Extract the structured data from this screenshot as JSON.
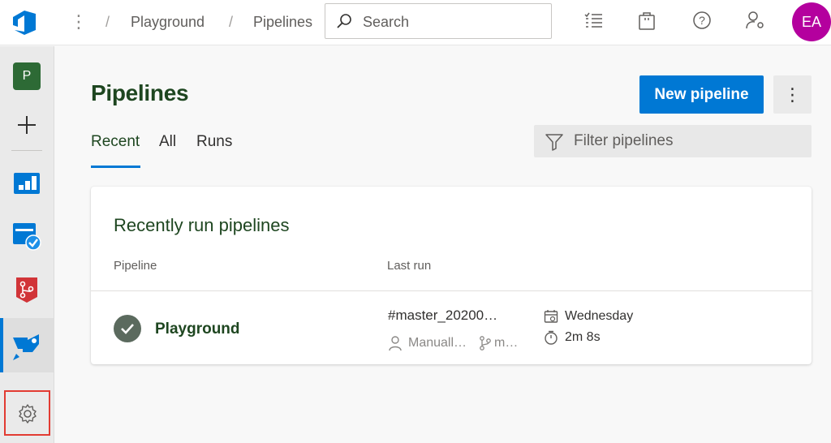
{
  "topbar": {
    "breadcrumb": [
      "Playground",
      "Pipelines"
    ],
    "search_placeholder": "Search",
    "avatar_initials": "EA"
  },
  "sidebar": {
    "project_initial": "P",
    "items": [
      "project",
      "add",
      "boards",
      "test-plans",
      "repos",
      "pipelines",
      "project-settings"
    ]
  },
  "main": {
    "title": "Pipelines",
    "new_pipeline_label": "New pipeline",
    "more_label": "⋮",
    "tabs": [
      "Recent",
      "All",
      "Runs"
    ],
    "selected_tab": "Recent",
    "filter_placeholder": "Filter pipelines"
  },
  "card": {
    "title": "Recently run pipelines",
    "columns": [
      "Pipeline",
      "Last run"
    ],
    "rows": [
      {
        "pipeline": "Playground",
        "status": "succeeded",
        "run_name": "#master_20200…",
        "trigger": "Manuall…",
        "branch": "m…",
        "day": "Wednesday",
        "duration": "2m 8s"
      }
    ]
  },
  "colors": {
    "accent": "#0078d4",
    "title_green": "#1e4620",
    "avatar": "#b4009e",
    "highlight_box": "#e23b32"
  }
}
